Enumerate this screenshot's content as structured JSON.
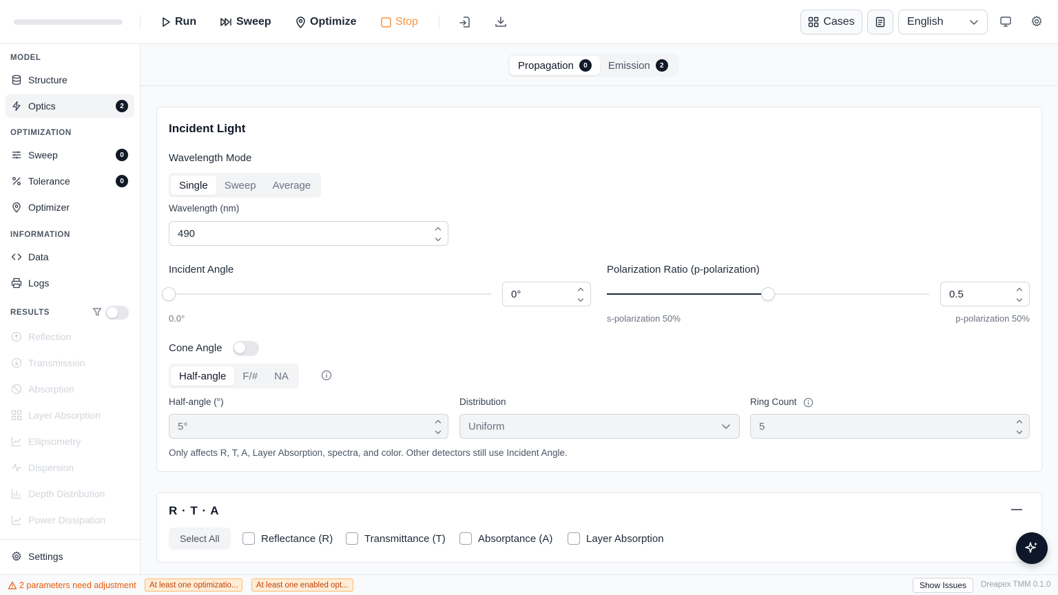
{
  "toolbar": {
    "run": "Run",
    "sweep": "Sweep",
    "optimize": "Optimize",
    "stop": "Stop",
    "cases": "Cases",
    "language": "English"
  },
  "sidebar": {
    "model_label": "MODEL",
    "structure": "Structure",
    "optics": "Optics",
    "optics_badge": "2",
    "optimization_label": "OPTIMIZATION",
    "sweep": "Sweep",
    "sweep_badge": "0",
    "tolerance": "Tolerance",
    "tolerance_badge": "0",
    "optimizer": "Optimizer",
    "information_label": "INFORMATION",
    "data": "Data",
    "logs": "Logs",
    "results_label": "RESULTS",
    "results": [
      "Reflection",
      "Transmission",
      "Absorption",
      "Layer Absorption",
      "Ellipsometry",
      "Dispersion",
      "Depth Distribution",
      "Power Dissipation"
    ],
    "settings": "Settings"
  },
  "tabs": [
    {
      "label": "Propagation",
      "badge": "0"
    },
    {
      "label": "Emission",
      "badge": "2"
    }
  ],
  "incident": {
    "title": "Incident Light",
    "wavelength_mode_label": "Wavelength Mode",
    "modes": [
      "Single",
      "Sweep",
      "Average"
    ],
    "wavelength_label": "Wavelength (nm)",
    "wavelength_value": "490",
    "angle_label": "Incident Angle",
    "angle_value": "0°",
    "angle_readout": "0.0°",
    "angle_fraction": 0,
    "pol_label": "Polarization Ratio (p-polarization)",
    "pol_value": "0.5",
    "pol_fraction": 0.5,
    "pol_left": "s-polarization 50%",
    "pol_right": "p-polarization 50%",
    "cone_label": "Cone Angle",
    "cone_modes": [
      "Half-angle",
      "F/#",
      "NA"
    ],
    "half_angle_label": "Half-angle (°)",
    "half_angle_value": "5°",
    "distribution_label": "Distribution",
    "distribution_value": "Uniform",
    "ring_label": "Ring Count",
    "ring_value": "5",
    "note": "Only affects R, T, A, Layer Absorption, spectra, and color. Other detectors still use Incident Angle."
  },
  "rta": {
    "title": "R · T · A",
    "select_all": "Select All",
    "options": [
      "Reflectance (R)",
      "Transmittance (T)",
      "Absorptance (A)",
      "Layer Absorption"
    ]
  },
  "status": {
    "warning": "2 parameters need adjustment",
    "chips": [
      "At least one optimizatio...",
      "At least one enabled opt..."
    ],
    "show_issues": "Show Issues",
    "version": "Dreapex TMM 0.1.0"
  },
  "colors": {
    "accent": "#111827",
    "warning": "#ea580c",
    "stop": "#fb923c"
  }
}
